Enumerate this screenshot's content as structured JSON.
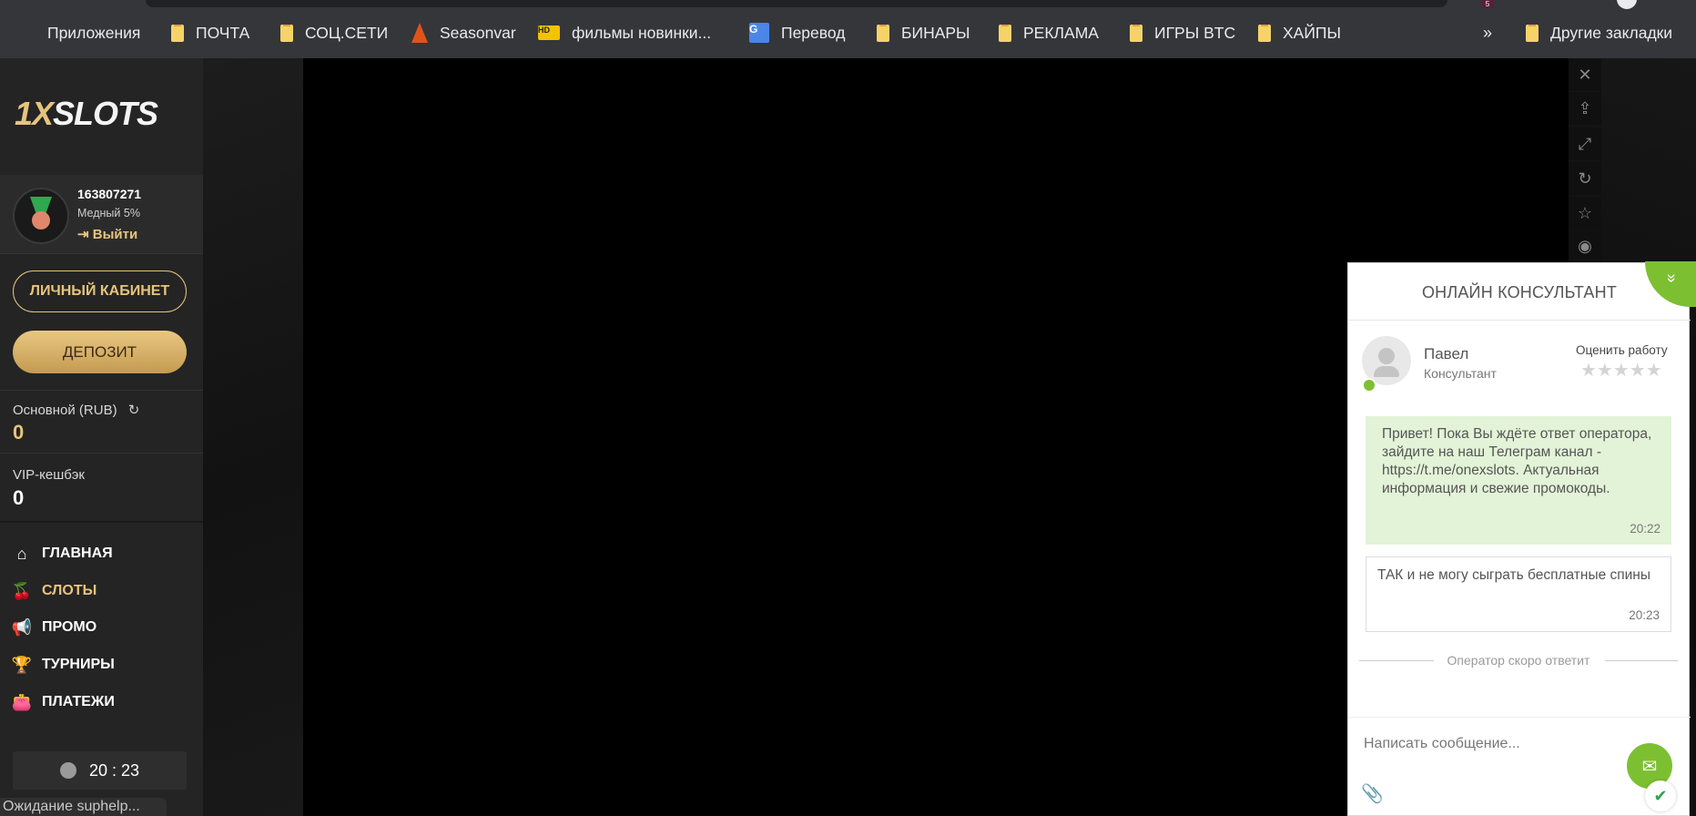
{
  "browser": {
    "badge": "5",
    "bookmarks": [
      {
        "label": "Приложения",
        "icon": "apps-grid-icon"
      },
      {
        "label": "ПОЧТА",
        "icon": "folder-icon"
      },
      {
        "label": "СОЦ.СЕТИ",
        "icon": "folder-icon"
      },
      {
        "label": "Seasonvar",
        "icon": "seasonvar-icon"
      },
      {
        "label": "фильмы новинки...",
        "icon": "hd-icon"
      },
      {
        "label": "Перевод",
        "icon": "translate-icon"
      },
      {
        "label": "БИНАРЫ",
        "icon": "folder-icon"
      },
      {
        "label": "РЕКЛАМА",
        "icon": "folder-icon"
      },
      {
        "label": "ИГРЫ BTC",
        "icon": "folder-icon"
      },
      {
        "label": "ХАЙПЫ",
        "icon": "folder-icon"
      }
    ],
    "more": "»",
    "other_bookmarks": "Другие закладки",
    "hd_badge": "HD",
    "translate_badge": "G"
  },
  "sidebar": {
    "logo_prefix": "1X",
    "logo_suffix": "SLOTS",
    "user": {
      "id": "163807271",
      "rank": "Медный 5%",
      "logout": "Выйти"
    },
    "cabinet_button": "ЛИЧНЫЙ КАБИНЕТ",
    "deposit_button": "ДЕПОЗИТ",
    "balance_label": "Основной (RUB)",
    "balance_value": "0",
    "cashback_label": "VIP-кешбэк",
    "cashback_value": "0",
    "nav": [
      {
        "label": "ГЛАВНАЯ",
        "icon": "home-icon"
      },
      {
        "label": "СЛОТЫ",
        "icon": "cherries-icon",
        "active": true
      },
      {
        "label": "ПРОМО",
        "icon": "megaphone-icon"
      },
      {
        "label": "ТУРНИРЫ",
        "icon": "trophy-icon"
      },
      {
        "label": "ПЛАТЕЖИ",
        "icon": "wallet-icon"
      }
    ],
    "clock": "20 : 23",
    "status": "Ожидание suphelp..."
  },
  "chat": {
    "title": "ОНЛАЙН КОНСУЛЬТАНТ",
    "operator_name": "Павел",
    "operator_role": "Консультант",
    "rate_label": "Оценить работу",
    "stars": "★★★★★",
    "messages": [
      {
        "text": "Привет! Пока Вы ждёте ответ оператора, зайдите на наш Телеграм канал - https://t.me/onexslots. Актуальная информация и свежие промокоды.",
        "time": "20:22"
      },
      {
        "text": "ТАК и не могу сыграть бесплатные спины",
        "time": "20:23"
      }
    ],
    "operator_status": "Оператор скоро ответит",
    "composer_placeholder": "Написать сообщение..."
  },
  "colors": {
    "accent_gold": "#e7c47c",
    "chat_green": "#7cc032",
    "sidebar_bg": "#242424"
  }
}
